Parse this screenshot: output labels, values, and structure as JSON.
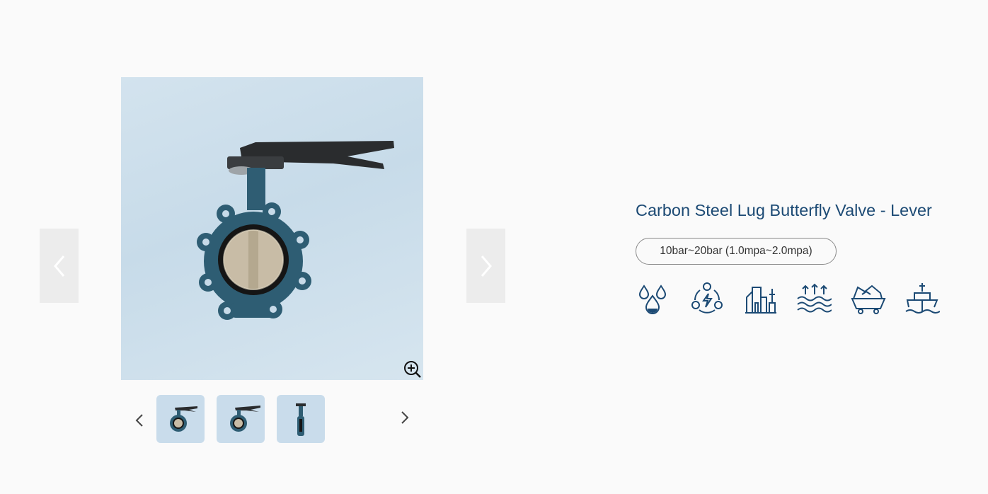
{
  "product": {
    "title": "Carbon Steel Lug Butterfly Valve - Lever",
    "pressure_rating": "10bar~20bar (1.0mpa~2.0mpa)"
  },
  "gallery": {
    "thumbnail_count": 3,
    "active_thumbnail": 1
  },
  "application_icons": [
    "water-drops-icon",
    "energy-cycle-icon",
    "industrial-buildings-icon",
    "water-waves-icon",
    "mining-cart-icon",
    "ship-icon"
  ],
  "colors": {
    "page_background": "#fafafa",
    "title_color": "#1c4a74",
    "icon_color": "#1c4a74",
    "image_background": "#cfe0ec",
    "arrow_button_bg": "#ececec"
  }
}
